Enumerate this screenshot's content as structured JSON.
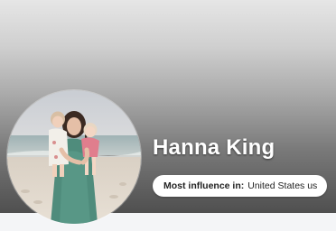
{
  "profile": {
    "name": "Hanna King",
    "influence_label": "Most influence in:",
    "influence_value": "United States us"
  },
  "avatar": {
    "icon": "profile-photo"
  }
}
